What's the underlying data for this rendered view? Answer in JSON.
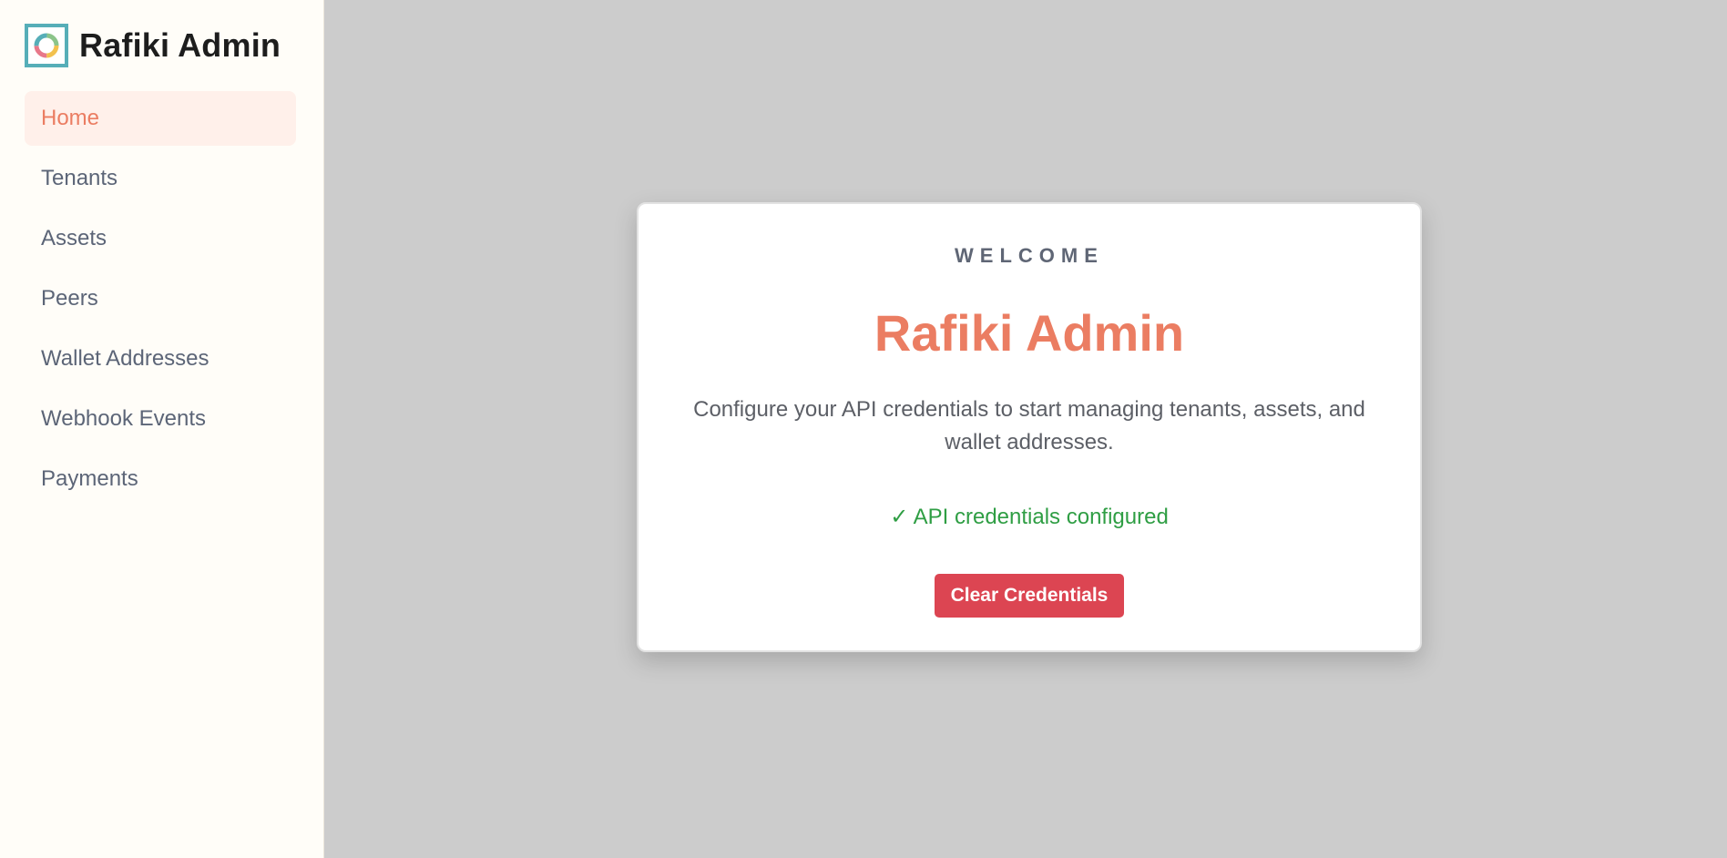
{
  "brand": {
    "title": "Rafiki Admin",
    "logo_icon": "rafiki-ring-logo-icon",
    "logo_border_color": "#56aeb8"
  },
  "sidebar": {
    "items": [
      {
        "label": "Home",
        "active": true
      },
      {
        "label": "Tenants",
        "active": false
      },
      {
        "label": "Assets",
        "active": false
      },
      {
        "label": "Peers",
        "active": false
      },
      {
        "label": "Wallet Addresses",
        "active": false
      },
      {
        "label": "Webhook Events",
        "active": false
      },
      {
        "label": "Payments",
        "active": false
      }
    ]
  },
  "card": {
    "eyebrow": "WELCOME",
    "title": "Rafiki Admin",
    "description": "Configure your API credentials to start managing tenants, assets, and wallet addresses.",
    "status": "✓ API credentials configured",
    "clear_button": "Clear Credentials"
  },
  "colors": {
    "accent": "#eb7d62",
    "active_bg": "#fff0ea",
    "success": "#2f9e44",
    "danger": "#dc4552",
    "backdrop": "#cccccc"
  }
}
